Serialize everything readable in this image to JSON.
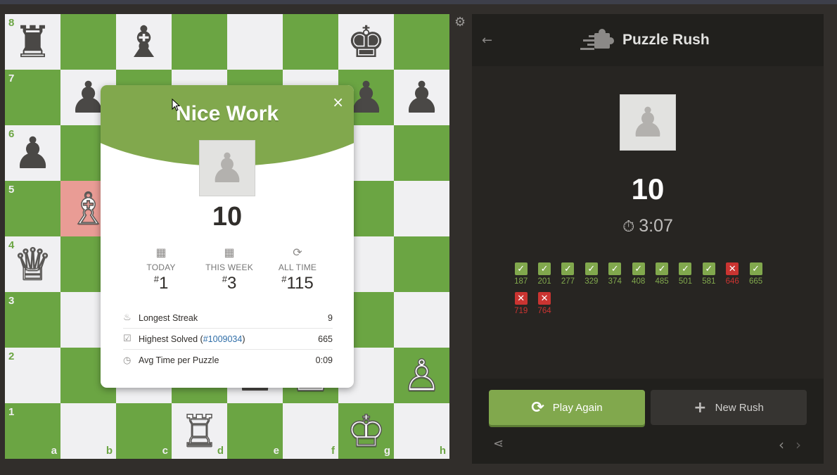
{
  "board": {
    "pieces": {
      "a8": "♜",
      "c8": "♝",
      "g8": "♚",
      "b7": "♟",
      "g7": "♟",
      "h7": "♟",
      "a6": "♟",
      "b5": "♗",
      "a4": "♕",
      "f3": "♙",
      "h2": "♙",
      "d1": "♖",
      "g1": "♔",
      "e2": "♟",
      "f2": "♙"
    },
    "rank_labels": [
      "8",
      "7",
      "6",
      "5",
      "4",
      "3",
      "2",
      "1"
    ],
    "file_labels": [
      "a",
      "b",
      "c",
      "d",
      "e",
      "f",
      "g",
      "h"
    ],
    "highlight": "b5",
    "settings_icon": "gear-icon"
  },
  "modal": {
    "title": "Nice Work",
    "close_label": "×",
    "score": "10",
    "ranks": [
      {
        "icon": "calendar-icon",
        "label": "TODAY",
        "prefix": "#",
        "value": "1"
      },
      {
        "icon": "calendar-icon",
        "label": "THIS WEEK",
        "prefix": "#",
        "value": "3"
      },
      {
        "icon": "refresh-icon",
        "label": "ALL TIME",
        "prefix": "#",
        "value": "115"
      }
    ],
    "stats": {
      "streak_label": "Longest Streak",
      "streak_value": "9",
      "highest_label": "Highest Solved (",
      "highest_link": "#1009034",
      "highest_close": ")",
      "highest_value": "665",
      "avg_label": "Avg Time per Puzzle",
      "avg_value": "0:09"
    }
  },
  "panel": {
    "title": "Puzzle Rush",
    "score": "10",
    "time": "3:07",
    "results": [
      {
        "n": "187",
        "ok": true
      },
      {
        "n": "201",
        "ok": true
      },
      {
        "n": "277",
        "ok": true
      },
      {
        "n": "329",
        "ok": true
      },
      {
        "n": "374",
        "ok": true
      },
      {
        "n": "408",
        "ok": true
      },
      {
        "n": "485",
        "ok": true
      },
      {
        "n": "501",
        "ok": true
      },
      {
        "n": "581",
        "ok": true
      },
      {
        "n": "646",
        "ok": false
      },
      {
        "n": "665",
        "ok": true
      },
      {
        "n": "719",
        "ok": false
      },
      {
        "n": "764",
        "ok": false
      }
    ],
    "play_again": "Play Again",
    "new_rush": "New Rush"
  },
  "colors": {
    "board_dark": "#6ba543",
    "board_light": "#f0f0f2",
    "accent_green": "#81a84d",
    "error_red": "#ca3431",
    "panel_bg": "#272522"
  }
}
